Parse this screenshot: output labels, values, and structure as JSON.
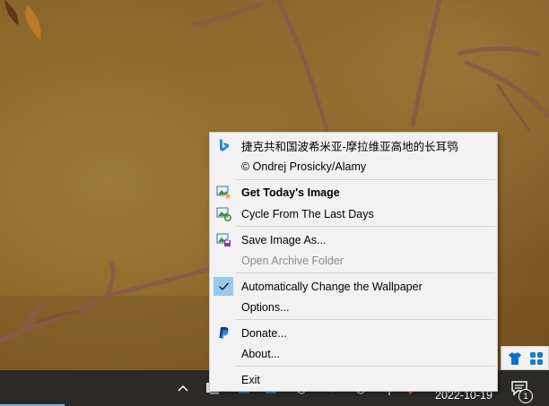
{
  "menu": {
    "items": [
      {
        "label": "捷克共和国波希米亚-摩拉维亚高地的长耳鸮",
        "icon": "bing-logo-icon",
        "state": "normal"
      },
      {
        "label": "© Ondrej Prosicky/Alamy",
        "icon": "",
        "state": "normal"
      },
      {
        "label": "Get Today's Image",
        "icon": "image-star-icon",
        "state": "bold"
      },
      {
        "label": "Cycle From The Last Days",
        "icon": "image-cycle-icon",
        "state": "normal"
      },
      {
        "label": "Save Image As...",
        "icon": "image-save-icon",
        "state": "normal"
      },
      {
        "label": "Open Archive Folder",
        "icon": "",
        "state": "disabled"
      },
      {
        "label": "Automatically Change the Wallpaper",
        "icon": "checkmark-icon",
        "state": "checked"
      },
      {
        "label": "Options...",
        "icon": "",
        "state": "normal"
      },
      {
        "label": "Donate...",
        "icon": "paypal-icon",
        "state": "normal"
      },
      {
        "label": "About...",
        "icon": "",
        "state": "normal"
      },
      {
        "label": "Exit",
        "icon": "",
        "state": "normal"
      }
    ]
  },
  "taskbar": {
    "date": "2022-10-19",
    "notification_count": "1"
  },
  "tray_flyout": {
    "icons": [
      "shirt-icon",
      "grid-app-icon"
    ]
  },
  "colors": {
    "menu_bg": "#f2f2f2",
    "checked_bg": "#99c9ef",
    "taskbar_bg": "#2b2a27",
    "accent": "#0078d7"
  }
}
